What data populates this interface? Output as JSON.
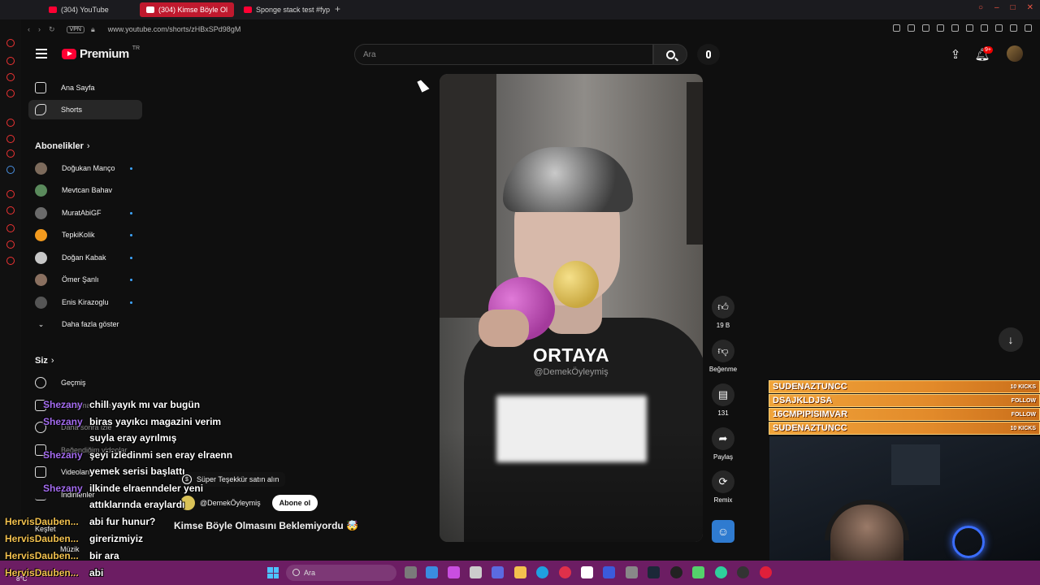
{
  "browser": {
    "tabs": [
      {
        "label": "(304) YouTube"
      },
      {
        "label": "(304) Kimse Böyle Ol"
      },
      {
        "label": "Sponge stack test #fyp #"
      }
    ],
    "new_tab": "+",
    "vpn": "VPN",
    "url": "www.youtube.com/shorts/zHBxSPd98gM"
  },
  "header": {
    "logo_text": "Premium",
    "logo_region": "TR",
    "search_placeholder": "Ara",
    "notif_badge": "9+"
  },
  "sidebar": {
    "main": [
      {
        "label": "Ana Sayfa"
      },
      {
        "label": "Shorts"
      }
    ],
    "subs_title": "Abonelikler",
    "subs": [
      {
        "label": "Doğukan Manço",
        "color": "#7d6b5c"
      },
      {
        "label": "Mevtcan Bahav",
        "color": "#5a8a5c"
      },
      {
        "label": "MuratAbiGF",
        "color": "#6a6a6a"
      },
      {
        "label": "TepkiKolik",
        "color": "#f39a1e"
      },
      {
        "label": "Doğan Kabak",
        "color": "#c7c7c7"
      },
      {
        "label": "Ömer Şanlı",
        "color": "#8a7060"
      },
      {
        "label": "Enis Kirazoglu",
        "color": "#555555"
      }
    ],
    "show_more": "Daha fazla göster",
    "you_title": "Siz",
    "you_items": [
      {
        "label": "Geçmiş"
      },
      {
        "label": "Oynatma listeleri"
      },
      {
        "label": "Daha sonra izle"
      },
      {
        "label": "Beğendiğim videolar"
      },
      {
        "label": "Videolarım"
      },
      {
        "label": "İndirilenler"
      }
    ],
    "explore": "Keşfet",
    "music": "Müzik"
  },
  "short": {
    "caption": "ORTAYA",
    "watermark": "@DemekÖyleymiş",
    "channel": "@DemekÖyleymiş",
    "subscribe": "Abone ol",
    "title": "Kimse Böyle Olmasını Beklemiyordu 🤯",
    "thanks_tip": "Süper Teşekkür satın alın"
  },
  "actions": {
    "like_count": "19 B",
    "dislike_label": "Beğenme",
    "comment_count": "131",
    "share_label": "Paylaş",
    "remix_label": "Remix"
  },
  "chat": [
    {
      "user": "Shezany",
      "msg": "chill yayık mı var bugün"
    },
    {
      "user": "Shezany",
      "msg": "biras yayıkcı magazini verim"
    },
    {
      "user": "",
      "msg": "suyla eray ayrılmış"
    },
    {
      "user": "Shezany",
      "msg": "şeyi izledinmi sen eray elraenn"
    },
    {
      "user": "",
      "msg": "yemek serisi başlattı"
    },
    {
      "user": "Shezany",
      "msg": "ilkinde elraenndeler yeni"
    },
    {
      "user": "",
      "msg": "attıklarında eraylardı"
    },
    {
      "user": "HervisDauben...",
      "msg": "abi fur hunur?"
    },
    {
      "user": "HervisDauben...",
      "msg": "girerizmiyiz"
    },
    {
      "user": "HervisDauben...",
      "msg": "bir ara"
    },
    {
      "user": "HervisDauben...",
      "msg": "abi"
    }
  ],
  "chat_colors": {
    "shezany": "#a46cf0",
    "hervis": "#f2c14e"
  },
  "alerts": [
    {
      "name": "SUDENAZTUNCC",
      "kind": "10 KICKS"
    },
    {
      "name": "DSAJKLDJSA",
      "kind": "FOLLOW"
    },
    {
      "name": "16CMPIPISIMVAR",
      "kind": "FOLLOW"
    },
    {
      "name": "SUDENAZTUNCC",
      "kind": "10 KICKS"
    }
  ],
  "taskbar": {
    "search": "Ara",
    "weather": "8°C"
  },
  "colors": {
    "accent": "#ff0033",
    "taskbar": "#6c1d63"
  }
}
